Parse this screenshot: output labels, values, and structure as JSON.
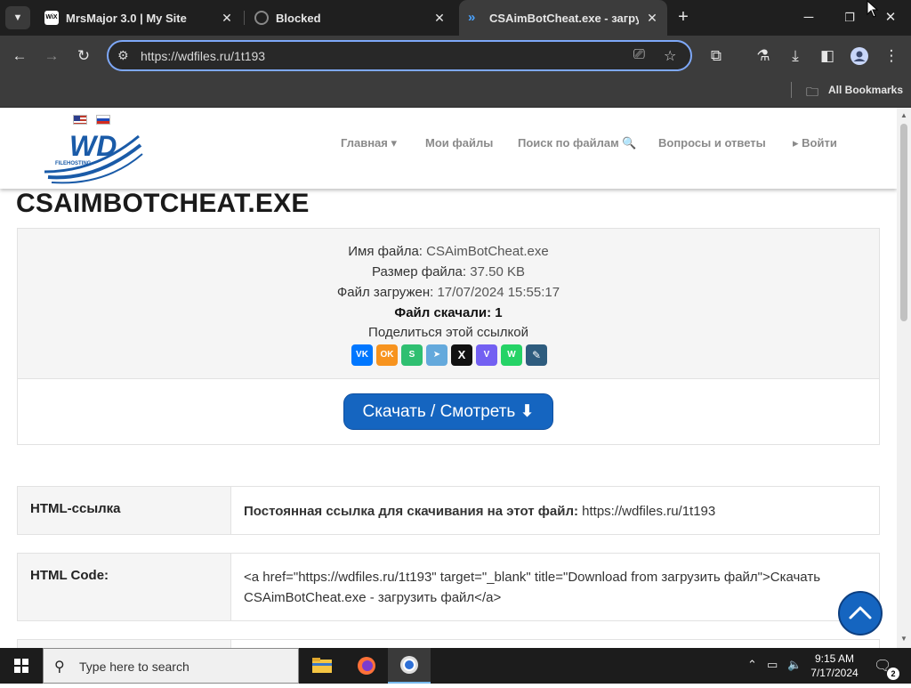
{
  "browser": {
    "tabs": [
      {
        "title": "MrsMajor 3.0 | My Site",
        "favicon": "wix-icon"
      },
      {
        "title": "Blocked",
        "favicon": "blocked-icon"
      },
      {
        "title": "CSAimBotCheat.exe - загрузит",
        "favicon": "wdfiles-icon"
      }
    ],
    "address": "https://wdfiles.ru/1t193",
    "bookmarks_label": "All Bookmarks"
  },
  "site": {
    "logo_text": "WD",
    "logo_sub": "FILEHOSTING",
    "nav": [
      {
        "label": "Главная ▾"
      },
      {
        "label": "Мои файлы"
      },
      {
        "label": "Поиск по файлам 🔍"
      },
      {
        "label": "Вопросы и ответы"
      },
      {
        "label": "▸ Войти"
      }
    ]
  },
  "file": {
    "title": "CSAIMBOTCHEAT.EXE",
    "name_label": "Имя файла:",
    "name_value": "CSAimBotCheat.exe",
    "size_label": "Размер файла:",
    "size_value": "37.50 KB",
    "uploaded_label": "Файл загружен:",
    "uploaded_value": "17/07/2024 15:55:17",
    "downloads_label": "Файл скачали:",
    "downloads_value": "1",
    "share_label": "Поделиться этой ссылкой",
    "download_button": "Скачать / Смотреть"
  },
  "share_buttons": [
    {
      "name": "vk",
      "glyph": "VK",
      "color": "#0077ff"
    },
    {
      "name": "odnoklassniki",
      "glyph": "OK",
      "color": "#f7931e"
    },
    {
      "name": "sferum",
      "glyph": "S",
      "color": "#2fbf71"
    },
    {
      "name": "telegram",
      "glyph": "➤",
      "color": "#64a9dc"
    },
    {
      "name": "x",
      "glyph": "X",
      "color": "#111111"
    },
    {
      "name": "viber",
      "glyph": "V",
      "color": "#7360f2"
    },
    {
      "name": "whatsapp",
      "glyph": "W",
      "color": "#25d366"
    },
    {
      "name": "livejournal",
      "glyph": "✎",
      "color": "#2e5c7e"
    }
  ],
  "rows": [
    {
      "key": "HTML-ссылка",
      "value_bold": "Постоянная ссылка для скачивания на этот файл:",
      "value": "https://wdfiles.ru/1t193"
    },
    {
      "key": "HTML Code:",
      "value": "<a href=\"https://wdfiles.ru/1t193\" target=\"_blank\" title=\"Download from загрузить файл\">Скачать CSAimBotCheat.exe - загрузить файл</a>"
    }
  ],
  "taskbar": {
    "search_placeholder": "Type here to search",
    "time": "9:15 AM",
    "date": "7/17/2024",
    "notification_count": "2"
  },
  "colors": {
    "accent_blue": "#1565c0",
    "chrome_dark": "#1f1f1f",
    "chrome_toolbar": "#3c3c3c",
    "focus_ring": "#7ea8f8"
  }
}
